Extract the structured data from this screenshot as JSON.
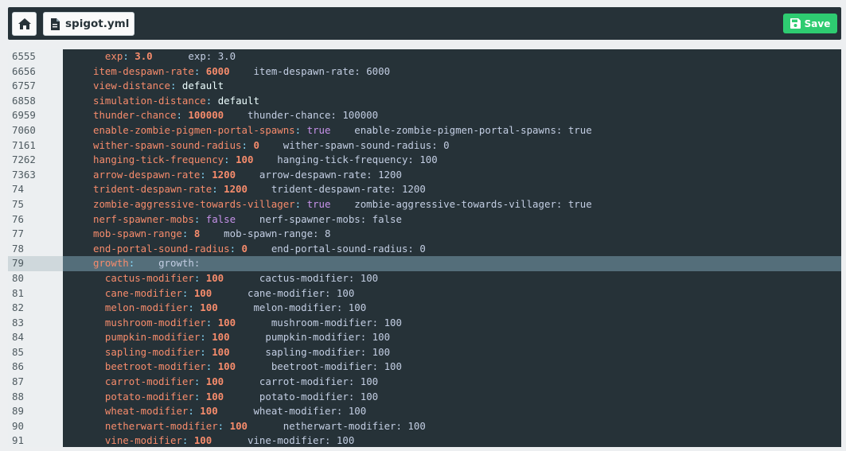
{
  "toolbar": {
    "file_name": "spigot.yml",
    "save_label": "Save"
  },
  "colors": {
    "save_green": "#2ecc71",
    "editor_bg": "#263238",
    "key": "#f78c6c",
    "boolean": "#c792ea"
  },
  "editor": {
    "lines": [
      {
        "num": "6555",
        "indent": 2,
        "key": "exp",
        "val": "3.0",
        "type": "num",
        "ghost": "exp: 3.0",
        "gap": 6
      },
      {
        "num": "6656",
        "indent": 0,
        "key": "item-despawn-rate",
        "val": "6000",
        "type": "num",
        "ghost": "item-despawn-rate: 6000",
        "gap": 4
      },
      {
        "num": "6757",
        "indent": 0,
        "key": "view-distance",
        "val": "default",
        "type": "str",
        "ghost": "",
        "gap": 0
      },
      {
        "num": "6858",
        "indent": 0,
        "key": "simulation-distance",
        "val": "default",
        "type": "str",
        "ghost": "",
        "gap": 0
      },
      {
        "num": "6959",
        "indent": 0,
        "key": "thunder-chance",
        "val": "100000",
        "type": "num",
        "ghost": "thunder-chance: 100000",
        "gap": 4
      },
      {
        "num": "7060",
        "indent": 0,
        "key": "enable-zombie-pigmen-portal-spawns",
        "val": "true",
        "type": "bool",
        "ghost": "enable-zombie-pigmen-portal-spawns: true",
        "gap": 4
      },
      {
        "num": "7161",
        "indent": 0,
        "key": "wither-spawn-sound-radius",
        "val": "0",
        "type": "num",
        "ghost": "wither-spawn-sound-radius: 0",
        "gap": 4
      },
      {
        "num": "7262",
        "indent": 0,
        "key": "hanging-tick-frequency",
        "val": "100",
        "type": "num",
        "ghost": "hanging-tick-frequency: 100",
        "gap": 4
      },
      {
        "num": "7363",
        "indent": 0,
        "key": "arrow-despawn-rate",
        "val": "1200",
        "type": "num",
        "ghost": "arrow-despawn-rate: 1200",
        "gap": 4
      },
      {
        "num": "74",
        "indent": 0,
        "key": "trident-despawn-rate",
        "val": "1200",
        "type": "num",
        "ghost": "trident-despawn-rate: 1200",
        "gap": 4
      },
      {
        "num": "75",
        "indent": 0,
        "key": "zombie-aggressive-towards-villager",
        "val": "true",
        "type": "bool",
        "ghost": "zombie-aggressive-towards-villager: true",
        "gap": 4
      },
      {
        "num": "76",
        "indent": 0,
        "key": "nerf-spawner-mobs",
        "val": "false",
        "type": "bool",
        "ghost": "nerf-spawner-mobs: false",
        "gap": 4
      },
      {
        "num": "77",
        "indent": 0,
        "key": "mob-spawn-range",
        "val": "8",
        "type": "num",
        "ghost": "mob-spawn-range: 8",
        "gap": 4
      },
      {
        "num": "78",
        "indent": 0,
        "key": "end-portal-sound-radius",
        "val": "0",
        "type": "num",
        "ghost": "end-portal-sound-radius: 0",
        "gap": 4
      },
      {
        "num": "79",
        "indent": 0,
        "key": "growth",
        "val": "",
        "type": "none",
        "ghost": "growth:",
        "gap": 4,
        "active": true
      },
      {
        "num": "80",
        "indent": 2,
        "key": "cactus-modifier",
        "val": "100",
        "type": "num",
        "ghost": "cactus-modifier: 100",
        "gap": 6
      },
      {
        "num": "81",
        "indent": 2,
        "key": "cane-modifier",
        "val": "100",
        "type": "num",
        "ghost": "cane-modifier: 100",
        "gap": 6
      },
      {
        "num": "82",
        "indent": 2,
        "key": "melon-modifier",
        "val": "100",
        "type": "num",
        "ghost": "melon-modifier: 100",
        "gap": 6
      },
      {
        "num": "83",
        "indent": 2,
        "key": "mushroom-modifier",
        "val": "100",
        "type": "num",
        "ghost": "mushroom-modifier: 100",
        "gap": 6
      },
      {
        "num": "84",
        "indent": 2,
        "key": "pumpkin-modifier",
        "val": "100",
        "type": "num",
        "ghost": "pumpkin-modifier: 100",
        "gap": 6
      },
      {
        "num": "85",
        "indent": 2,
        "key": "sapling-modifier",
        "val": "100",
        "type": "num",
        "ghost": "sapling-modifier: 100",
        "gap": 6
      },
      {
        "num": "86",
        "indent": 2,
        "key": "beetroot-modifier",
        "val": "100",
        "type": "num",
        "ghost": "beetroot-modifier: 100",
        "gap": 6
      },
      {
        "num": "87",
        "indent": 2,
        "key": "carrot-modifier",
        "val": "100",
        "type": "num",
        "ghost": "carrot-modifier: 100",
        "gap": 6
      },
      {
        "num": "88",
        "indent": 2,
        "key": "potato-modifier",
        "val": "100",
        "type": "num",
        "ghost": "potato-modifier: 100",
        "gap": 6
      },
      {
        "num": "89",
        "indent": 2,
        "key": "wheat-modifier",
        "val": "100",
        "type": "num",
        "ghost": "wheat-modifier: 100",
        "gap": 6
      },
      {
        "num": "90",
        "indent": 2,
        "key": "netherwart-modifier",
        "val": "100",
        "type": "num",
        "ghost": "netherwart-modifier: 100",
        "gap": 6
      },
      {
        "num": "91",
        "indent": 2,
        "key": "vine-modifier",
        "val": "100",
        "type": "num",
        "ghost": "vine-modifier: 100",
        "gap": 6
      }
    ]
  }
}
